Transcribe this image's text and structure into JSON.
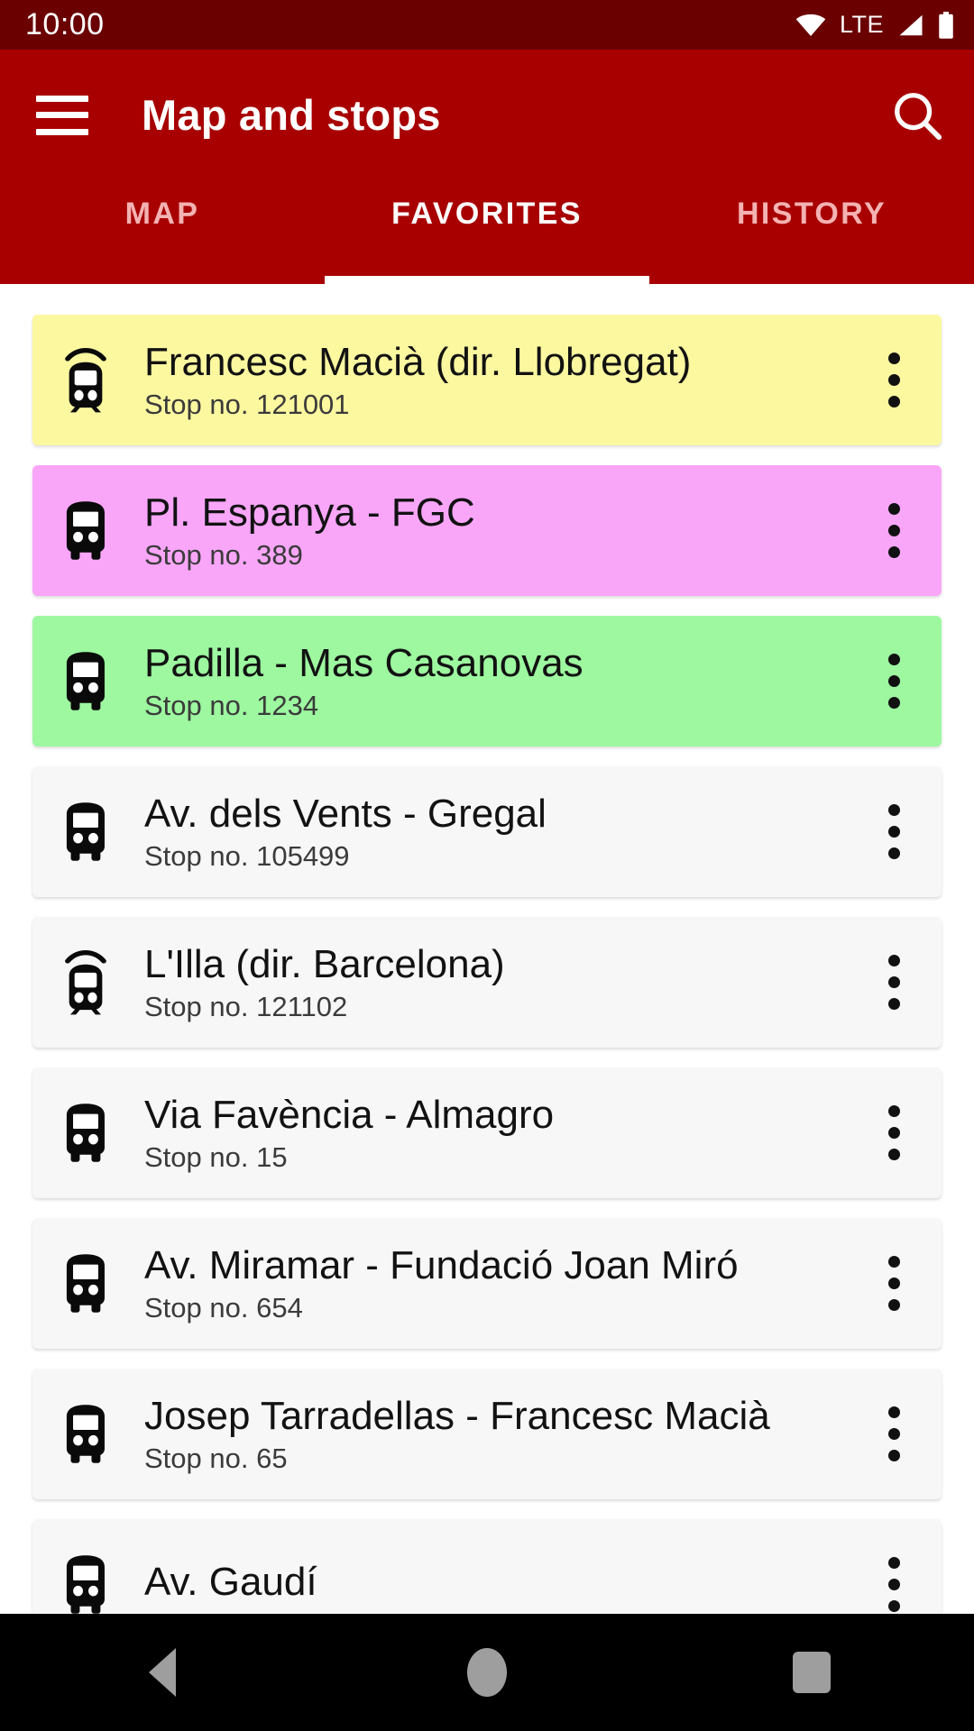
{
  "status_bar": {
    "time": "10:00",
    "network_label": "LTE",
    "icons": [
      "wifi-icon",
      "signal-icon",
      "battery-icon"
    ]
  },
  "app_bar": {
    "menu_icon": "hamburger-menu-icon",
    "title": "Map and stops",
    "search_icon": "search-icon",
    "background_color": "#a80000"
  },
  "tabs": {
    "items": [
      {
        "label": "MAP",
        "active": false
      },
      {
        "label": "FAVORITES",
        "active": true
      },
      {
        "label": "HISTORY",
        "active": false
      }
    ],
    "indicator_color": "#ffffff",
    "inactive_color": "#f4b2b2"
  },
  "favorites": {
    "items": [
      {
        "name": "Francesc Macià (dir. Llobregat)",
        "stop_number": "Stop no. 121001",
        "icon": "train-icon",
        "color": "#fcf8a0"
      },
      {
        "name": "Pl. Espanya - FGC",
        "stop_number": "Stop no. 389",
        "icon": "bus-icon",
        "color": "#f9a6f9"
      },
      {
        "name": "Padilla - Mas Casanovas",
        "stop_number": "Stop no. 1234",
        "icon": "bus-icon",
        "color": "#9df8a0"
      },
      {
        "name": "Av. dels Vents - Gregal",
        "stop_number": "Stop no. 105499",
        "icon": "bus-icon",
        "color": "#f7f7f7"
      },
      {
        "name": "L'Illa (dir. Barcelona)",
        "stop_number": "Stop no. 121102",
        "icon": "train-icon",
        "color": "#f7f7f7"
      },
      {
        "name": "Via Favència - Almagro",
        "stop_number": "Stop no. 15",
        "icon": "bus-icon",
        "color": "#f7f7f7"
      },
      {
        "name": "Av. Miramar - Fundació Joan Miró",
        "stop_number": "Stop no. 654",
        "icon": "bus-icon",
        "color": "#f7f7f7"
      },
      {
        "name": "Josep Tarradellas - Francesc Macià",
        "stop_number": "Stop no. 65",
        "icon": "bus-icon",
        "color": "#f7f7f7"
      },
      {
        "name": "Av. Gaudí",
        "stop_number": "",
        "icon": "bus-icon",
        "color": "#f7f7f7"
      }
    ],
    "overflow_icon": "kebab-menu-icon"
  },
  "nav_bar": {
    "back_label": "back-icon",
    "home_label": "home-icon",
    "recents_label": "recents-icon"
  }
}
